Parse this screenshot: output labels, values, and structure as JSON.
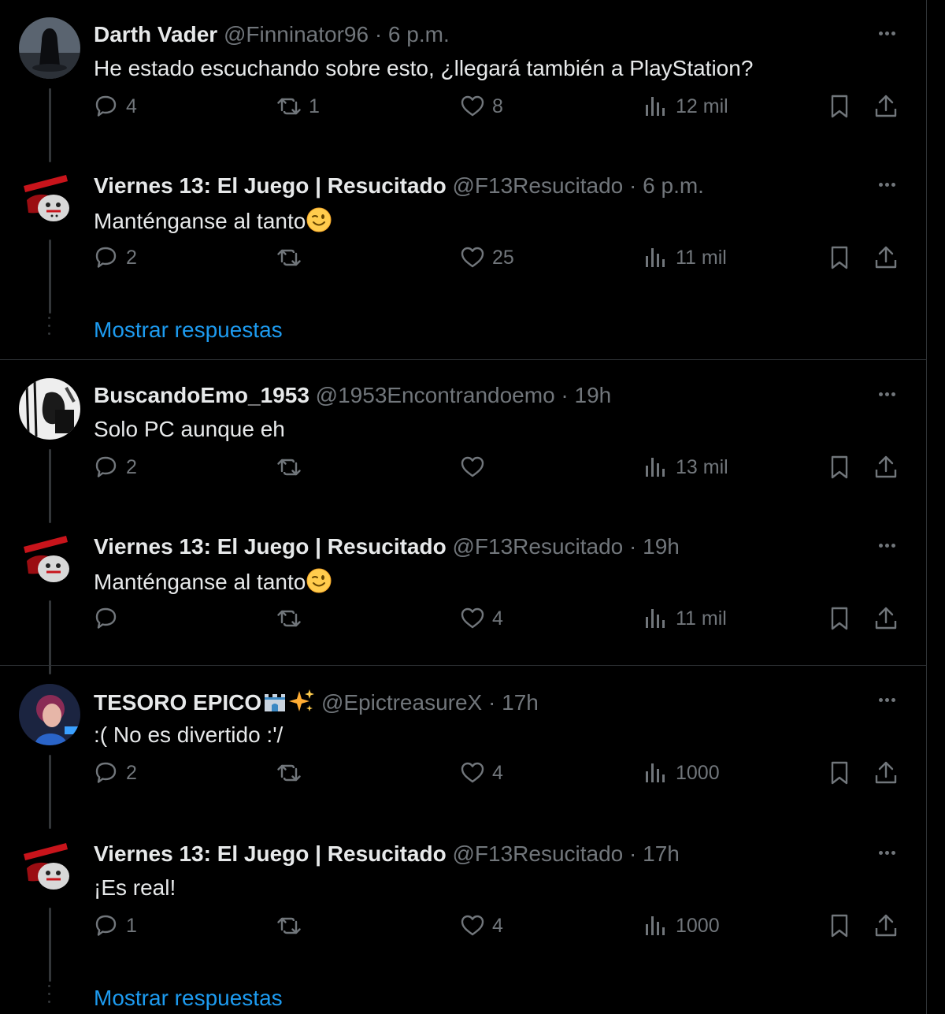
{
  "colors": {
    "background": "#000000",
    "text": "#e7e9ea",
    "muted": "#71767b",
    "link": "#1d9bf0",
    "divider": "#2f3336"
  },
  "icons": {
    "reply": "speech-bubble-icon",
    "retweet": "repost-icon",
    "like": "heart-icon",
    "views": "bar-chart-icon",
    "bookmark": "bookmark-icon",
    "share": "share-icon",
    "more": "ellipsis-icon"
  },
  "show_replies_label": "Mostrar respuestas",
  "tweets": [
    {
      "name": "Darth Vader",
      "handle": "@Finninator96",
      "dot": "·",
      "time": "6 p.m.",
      "text": "He estado escuchando sobre esto, ¿llegará también a PlayStation?",
      "replies": "4",
      "retweets": "1",
      "likes": "8",
      "views": "12 mil"
    },
    {
      "name": "Viernes 13: El Juego | Resucitado",
      "handle": "@F13Resucitado",
      "dot": "·",
      "time": "6 p.m.",
      "text": "Manténganse al tanto",
      "emoji": "winking-face",
      "replies": "2",
      "retweets": "",
      "likes": "25",
      "views": "11 mil"
    },
    {
      "name": "BuscandoEmo_1953",
      "handle": "@1953Encontrandoemo",
      "dot": "·",
      "time": "19h",
      "text": "Solo PC aunque eh",
      "replies": "2",
      "retweets": "",
      "likes": "",
      "views": "13 mil"
    },
    {
      "name": "Viernes 13: El Juego | Resucitado",
      "handle": "@F13Resucitado",
      "dot": "·",
      "time": "19h",
      "text": "Manténganse al tanto",
      "emoji": "winking-face",
      "replies": "",
      "retweets": "",
      "likes": "4",
      "views": "11 mil"
    },
    {
      "name": "TESORO EPICO",
      "name_emojis": "castle, sparkles",
      "handle": "@EpictreasureX",
      "dot": "·",
      "time": "17h",
      "text": ":( No es divertido :'/",
      "replies": "2",
      "retweets": "",
      "likes": "4",
      "views": "1000"
    },
    {
      "name": "Viernes 13: El Juego | Resucitado",
      "handle": "@F13Resucitado",
      "dot": "·",
      "time": "17h",
      "text": "¡Es real!",
      "replies": "1",
      "retweets": "",
      "likes": "4",
      "views": "1000"
    }
  ]
}
